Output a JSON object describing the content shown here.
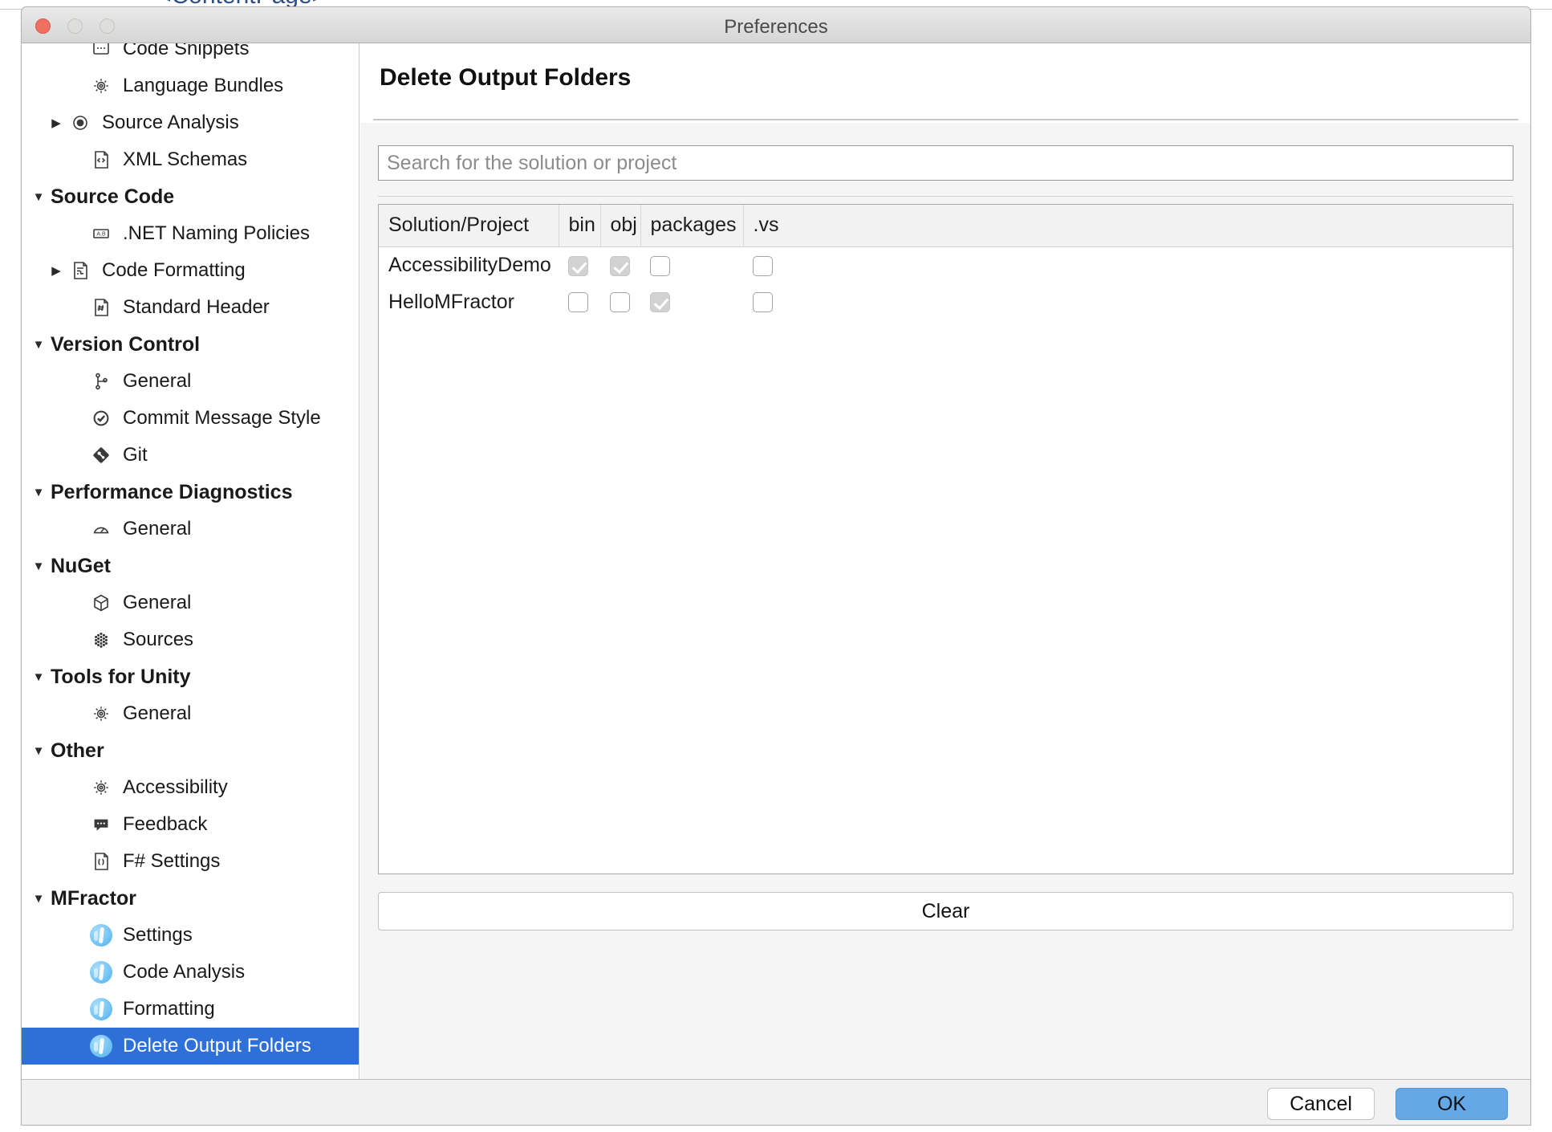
{
  "backdrop": {
    "obscured_text": "<ContentPage>"
  },
  "window": {
    "title": "Preferences",
    "traffic_lights": [
      {
        "name": "close",
        "color": "#ef6f60"
      },
      {
        "name": "minimize",
        "color": "#dededc"
      },
      {
        "name": "zoom",
        "color": "#dededc"
      }
    ]
  },
  "sidebar": {
    "items": [
      {
        "label": "Code Snippets",
        "type": "leaf",
        "icon": "snippet-icon",
        "arrow": "none",
        "selected": false
      },
      {
        "label": "Language Bundles",
        "type": "leaf",
        "icon": "gear-icon",
        "arrow": "none",
        "selected": false
      },
      {
        "label": "Source Analysis",
        "type": "leaf",
        "icon": "radio-target-icon",
        "arrow": "collapsed",
        "selected": false
      },
      {
        "label": "XML Schemas",
        "type": "leaf",
        "icon": "xml-file-icon",
        "arrow": "none",
        "selected": false
      },
      {
        "label": "Source Code",
        "type": "group",
        "icon": "none",
        "arrow": "expanded",
        "selected": false
      },
      {
        "label": ".NET Naming Policies",
        "type": "leaf",
        "icon": "naming-ab-icon",
        "arrow": "none",
        "selected": false
      },
      {
        "label": "Code Formatting",
        "type": "leaf",
        "icon": "code-format-icon",
        "arrow": "collapsed",
        "selected": false
      },
      {
        "label": "Standard Header",
        "type": "leaf",
        "icon": "hash-file-icon",
        "arrow": "none",
        "selected": false
      },
      {
        "label": "Version Control",
        "type": "group",
        "icon": "none",
        "arrow": "expanded",
        "selected": false
      },
      {
        "label": "General",
        "type": "leaf",
        "icon": "branch-icon",
        "arrow": "none",
        "selected": false
      },
      {
        "label": "Commit Message Style",
        "type": "leaf",
        "icon": "check-circle-icon",
        "arrow": "none",
        "selected": false
      },
      {
        "label": "Git",
        "type": "leaf",
        "icon": "git-icon",
        "arrow": "none",
        "selected": false
      },
      {
        "label": "Performance Diagnostics",
        "type": "group",
        "icon": "none",
        "arrow": "expanded",
        "selected": false
      },
      {
        "label": "General",
        "type": "leaf",
        "icon": "gauge-icon",
        "arrow": "none",
        "selected": false
      },
      {
        "label": "NuGet",
        "type": "group",
        "icon": "none",
        "arrow": "expanded",
        "selected": false
      },
      {
        "label": "General",
        "type": "leaf",
        "icon": "package-cube-icon",
        "arrow": "none",
        "selected": false
      },
      {
        "label": "Sources",
        "type": "leaf",
        "icon": "nuget-sources-icon",
        "arrow": "none",
        "selected": false
      },
      {
        "label": "Tools for Unity",
        "type": "group",
        "icon": "none",
        "arrow": "expanded",
        "selected": false
      },
      {
        "label": "General",
        "type": "leaf",
        "icon": "gear-icon",
        "arrow": "none",
        "selected": false
      },
      {
        "label": "Other",
        "type": "group",
        "icon": "none",
        "arrow": "expanded",
        "selected": false
      },
      {
        "label": "Accessibility",
        "type": "leaf",
        "icon": "gear-icon",
        "arrow": "none",
        "selected": false
      },
      {
        "label": "Feedback",
        "type": "leaf",
        "icon": "speech-bubble-icon",
        "arrow": "none",
        "selected": false
      },
      {
        "label": "F# Settings",
        "type": "leaf",
        "icon": "braces-file-icon",
        "arrow": "none",
        "selected": false
      },
      {
        "label": "MFractor",
        "type": "group",
        "icon": "none",
        "arrow": "expanded",
        "selected": false
      },
      {
        "label": "Settings",
        "type": "leaf",
        "icon": "mfractor-logo-icon",
        "arrow": "none",
        "selected": false
      },
      {
        "label": "Code Analysis",
        "type": "leaf",
        "icon": "mfractor-logo-icon",
        "arrow": "none",
        "selected": false
      },
      {
        "label": "Formatting",
        "type": "leaf",
        "icon": "mfractor-logo-icon",
        "arrow": "none",
        "selected": false
      },
      {
        "label": "Delete Output Folders",
        "type": "leaf",
        "icon": "mfractor-logo-icon",
        "arrow": "none",
        "selected": true
      }
    ],
    "selection_color": "#2f6fd8"
  },
  "main": {
    "title": "Delete Output Folders",
    "search": {
      "value": "",
      "placeholder": "Search for the solution or project"
    },
    "table": {
      "columns": [
        "Solution/Project",
        "bin",
        "obj",
        "packages",
        ".vs"
      ],
      "rows": [
        {
          "name": "AccessibilityDemo",
          "bin": true,
          "obj": true,
          "packages": false,
          "vs": false
        },
        {
          "name": "HelloMFractor",
          "bin": false,
          "obj": false,
          "packages": true,
          "vs": false
        }
      ]
    },
    "clear_label": "Clear"
  },
  "footer": {
    "cancel_label": "Cancel",
    "ok_label": "OK",
    "ok_color": "#64a8e8"
  }
}
